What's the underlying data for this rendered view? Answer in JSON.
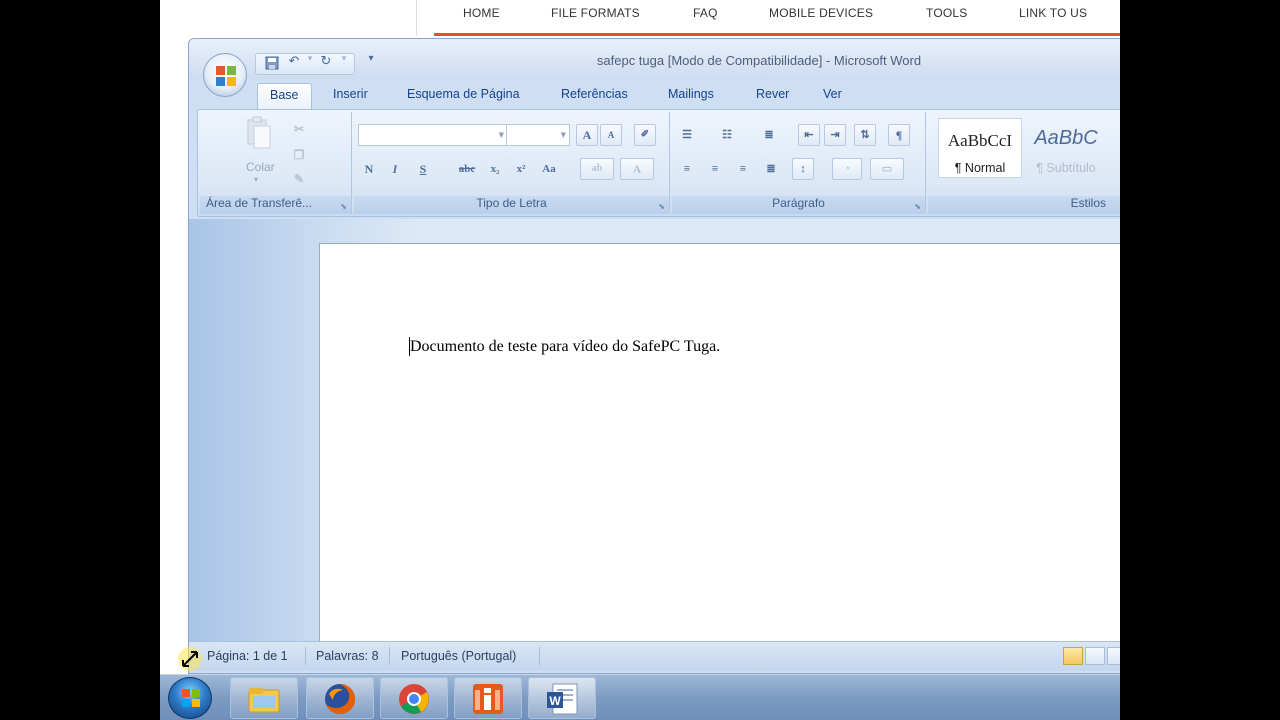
{
  "website_nav": {
    "items": [
      "HOME",
      "FILE FORMATS",
      "FAQ",
      "MOBILE DEVICES",
      "TOOLS",
      "LINK TO US"
    ]
  },
  "window": {
    "title": "safepc tuga [Modo de Compatibilidade] - Microsoft Word"
  },
  "tabs": [
    "Base",
    "Inserir",
    "Esquema de Página",
    "Referências",
    "Mailings",
    "Rever",
    "Ver"
  ],
  "active_tab": "Base",
  "ribbon": {
    "clipboard": {
      "label": "Área de Transferê...",
      "paste_label": "Colar"
    },
    "font": {
      "label": "Tipo de Letra",
      "bold": "N",
      "italic": "I",
      "underline": "S",
      "strike": "abc",
      "subscript": "x₂",
      "superscript": "x²",
      "case": "Aa",
      "grow": "A",
      "shrink": "A"
    },
    "paragraph": {
      "label": "Parágrafo",
      "pilcrow": "¶"
    },
    "styles": {
      "label": "Estilos",
      "normal_preview": "AaBbCcI",
      "normal_name": "¶ Normal",
      "subtitle_preview": "AaBbC",
      "subtitle_name": "¶ Subtítulo"
    }
  },
  "document": {
    "text": "Documento de teste para vídeo do SafePC Tuga."
  },
  "statusbar": {
    "page": "Página: 1 de 1",
    "words": "Palavras: 8",
    "language": "Português (Portugal)"
  },
  "taskbar": {
    "apps": [
      "explorer-icon",
      "firefox-icon",
      "chrome-icon",
      "app-icon",
      "word-icon"
    ]
  },
  "colors": {
    "accent": "#15428b",
    "nav_bar": "#e0561a",
    "ribbon_bg": "#dce8f6"
  }
}
